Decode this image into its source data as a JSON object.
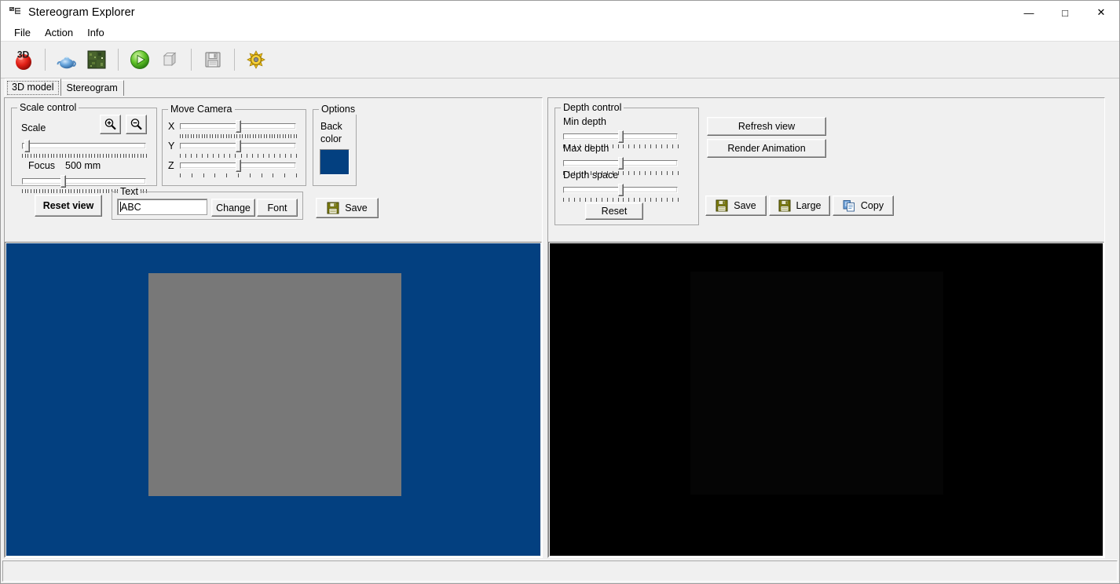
{
  "window": {
    "title": "Stereogram Explorer",
    "icon": "app-3d-icon",
    "minimize": "—",
    "maximize": "□",
    "close": "✕"
  },
  "menubar": {
    "items": [
      {
        "label": "File"
      },
      {
        "label": "Action"
      },
      {
        "label": "Info"
      }
    ]
  },
  "toolbar": {
    "buttons": [
      {
        "name": "new-3d-scene-button",
        "icon": "3d-sphere-icon",
        "enabled": true
      },
      {
        "name": "load-model-button",
        "icon": "teapot-icon",
        "enabled": true
      },
      {
        "name": "texture-button",
        "icon": "texture-swatch-icon",
        "enabled": true
      },
      {
        "name": "render-button",
        "icon": "green-play-icon",
        "enabled": true
      },
      {
        "name": "cube-button",
        "icon": "wireframe-cube-icon",
        "enabled": false
      },
      {
        "name": "save-button",
        "icon": "floppy-disk-icon",
        "enabled": false
      },
      {
        "name": "settings-button",
        "icon": "yellow-gear-icon",
        "enabled": true
      }
    ]
  },
  "tabs": {
    "items": [
      {
        "label": "3D model",
        "selected": true
      },
      {
        "label": "Stereogram",
        "selected": false
      }
    ]
  },
  "scale_control": {
    "group_title": "Scale control",
    "scale_label": "Scale",
    "zoom_in_icon": "zoom-in-icon",
    "zoom_out_icon": "zoom-out-icon",
    "scale_value_pct": 4,
    "focus_label": "Focus",
    "focus_value": "500 mm",
    "focus_slider_pct": 33
  },
  "move_camera": {
    "group_title": "Move Camera",
    "axes": [
      {
        "label": "X",
        "value_pct": 50,
        "ticks": 44
      },
      {
        "label": "Y",
        "value_pct": 50,
        "ticks": 22
      },
      {
        "label": "Z",
        "value_pct": 50,
        "ticks": 11
      }
    ]
  },
  "options": {
    "group_title": "Options",
    "back_color_label_line1": "Back",
    "back_color_label_line2": "color",
    "back_color_value": "#034080"
  },
  "left_actions": {
    "reset_view_label": "Reset view",
    "text_group_title": "Text",
    "text_value": "ABC",
    "text_placeholder": "",
    "change_label": "Change",
    "font_label": "Font",
    "save_label": "Save",
    "save_icon": "floppy-disk-icon"
  },
  "depth_control": {
    "group_title": "Depth control",
    "sliders": [
      {
        "label": "Min depth",
        "value_pct": 50,
        "ticks": 22
      },
      {
        "label": "Max depth",
        "value_pct": 50,
        "ticks": 22
      },
      {
        "label": "Depth space",
        "value_pct": 50,
        "ticks": 22
      }
    ],
    "reset_label": "Reset"
  },
  "right_actions": {
    "refresh_view_label": "Refresh view",
    "render_animation_label": "Render Animation",
    "save_label": "Save",
    "save_icon": "floppy-disk-icon",
    "large_label": "Large",
    "large_icon": "floppy-disk-icon",
    "copy_label": "Copy",
    "copy_icon": "copy-pages-icon"
  },
  "viewports": {
    "model_view": {
      "name": "3d-model-viewport",
      "background_color": "#034080",
      "object_color": "#787878"
    },
    "stereogram_view": {
      "name": "stereogram-viewport",
      "background_color": "#000000",
      "object_color": "#050505"
    }
  },
  "statusbar": {
    "text": ""
  }
}
